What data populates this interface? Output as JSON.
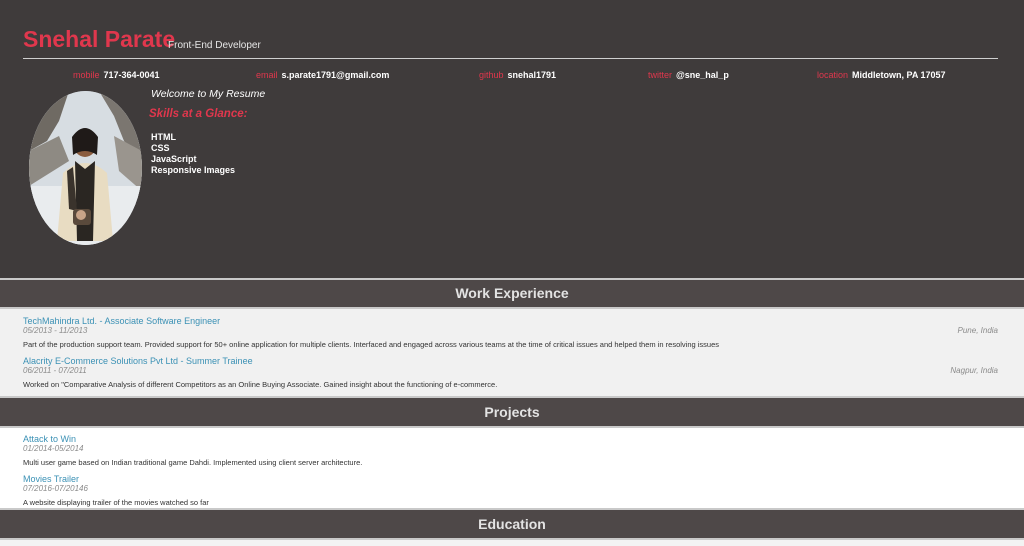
{
  "header": {
    "name": "Snehal Parate",
    "role": "Front-End Developer",
    "contacts": [
      {
        "label": "mobile",
        "value": "717-364-0041"
      },
      {
        "label": "email",
        "value": "s.parate1791@gmail.com"
      },
      {
        "label": "github",
        "value": "snehal1791"
      },
      {
        "label": "twitter",
        "value": "@sne_hal_p"
      },
      {
        "label": "location",
        "value": "Middletown, PA 17057"
      }
    ],
    "welcome": "Welcome to My Resume",
    "skills_heading": "Skills at a Glance:",
    "skills": [
      "HTML",
      "CSS",
      "JavaScript",
      "Responsive Images"
    ]
  },
  "work": {
    "heading": "Work Experience",
    "jobs": [
      {
        "title": "TechMahindra Ltd. - Associate Software Engineer",
        "dates": "05/2013 - 11/2013",
        "location": "Pune, India",
        "description": "Part of the production support team. Provided support for 50+ online application for multiple clients. Interfaced and engaged across various teams at the time of critical issues and helped them in resolving issues"
      },
      {
        "title": "Alacrity E-Commerce Solutions Pvt Ltd - Summer Trainee",
        "dates": "06/2011 - 07/2011",
        "location": "Nagpur, India",
        "description": "Worked on \"Comparative Analysis of different Competitors as an Online Buying Associate. Gained insight about the functioning of e-commerce."
      }
    ]
  },
  "projects": {
    "heading": "Projects",
    "items": [
      {
        "title": "Attack to Win",
        "dates": "01/2014-05/2014",
        "description": "Multi user game based on Indian traditional game Dahdi. Implemented using client server architecture."
      },
      {
        "title": "Movies Trailer",
        "dates": "07/2016-07/20146",
        "description": "A website displaying trailer of the movies watched so far"
      }
    ]
  },
  "education": {
    "heading": "Education"
  },
  "colors": {
    "accent": "#e0374d",
    "header_bg": "#3f3b3b",
    "section_bar": "#4e4848",
    "link": "#3b91b5"
  }
}
